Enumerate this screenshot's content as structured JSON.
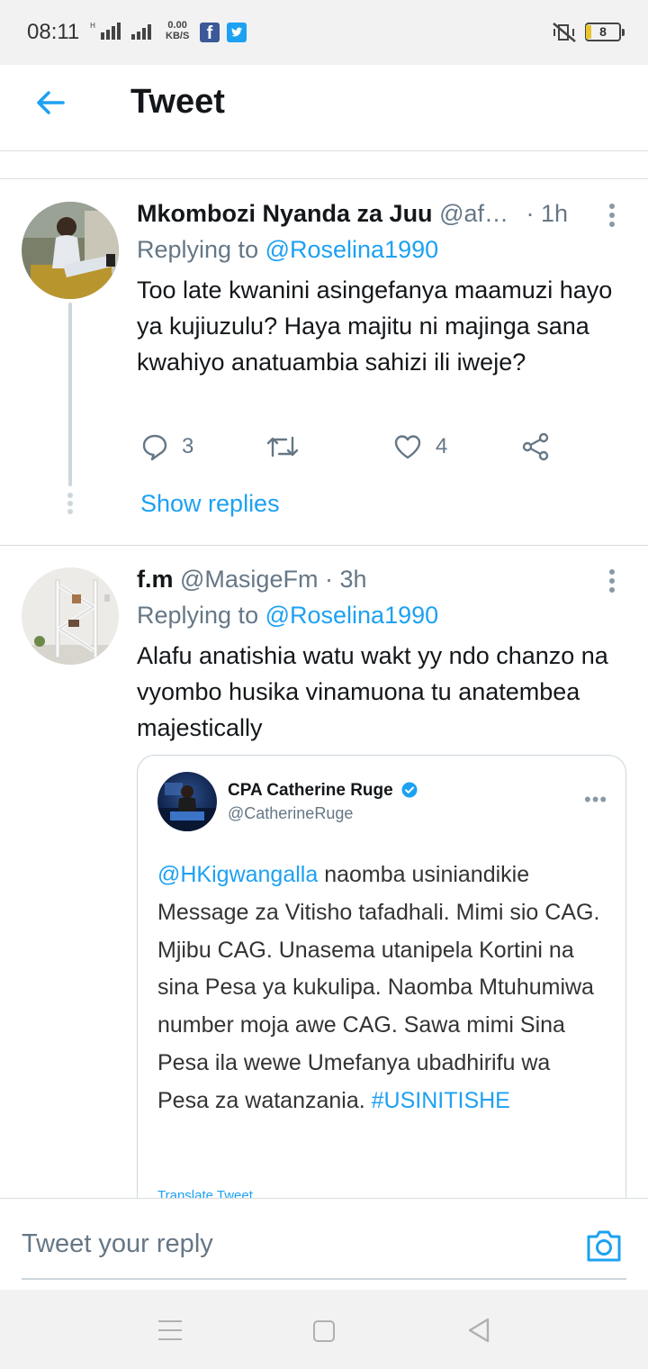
{
  "status_bar": {
    "time": "08:11",
    "network_speed_value": "0.00",
    "network_speed_unit": "KB/S",
    "battery": "8",
    "apps": [
      "facebook-icon",
      "twitter-icon"
    ]
  },
  "header": {
    "title": "Tweet",
    "back_icon": "arrow-left-icon"
  },
  "tweets": [
    {
      "author": "Mkombozi Nyanda za Juu",
      "handle": "@af…",
      "time": "· 1h",
      "replying_label": "Replying to",
      "replying_to": "@Roselina1990",
      "text": "Too late kwanini asingefanya maamuzi hayo ya kujiuzulu? Haya majitu ni majinga sana kwahiyo anatuambia sahizi ili iweje?",
      "replies": "3",
      "retweets": "",
      "likes": "4",
      "show_replies": "Show replies"
    },
    {
      "author": "f.m",
      "handle": "@MasigeFm",
      "time": "· 3h",
      "replying_label": "Replying to",
      "replying_to": "@Roselina1990",
      "text": "Alafu anatishia watu wakt yy ndo chanzo na vyombo husika vinamuona tu anatembea majestically",
      "quoted_image": {
        "name": "CPA Catherine Ruge",
        "handle": "@CatherineRuge",
        "mention": "@HKigwangalla",
        "text": " naomba usiniandikie Message za Vitisho tafadhali. Mimi sio CAG. Mjibu CAG. Unasema utanipela Kortini na sina Pesa ya kukulipa. Naomba Mtuhumiwa number moja awe CAG. Sawa mimi Sina Pesa ila wewe Umefanya ubadhirifu wa Pesa za watanzania. ",
        "hashtag": "#USINITISHE",
        "translate": "Translate Tweet",
        "more": "•••"
      }
    }
  ],
  "reply_bar": {
    "placeholder": "Tweet your reply",
    "camera_icon": "camera-icon"
  },
  "colors": {
    "accent": "#1da1f2",
    "secondary_text": "#657786",
    "divider": "#d9dde0"
  }
}
